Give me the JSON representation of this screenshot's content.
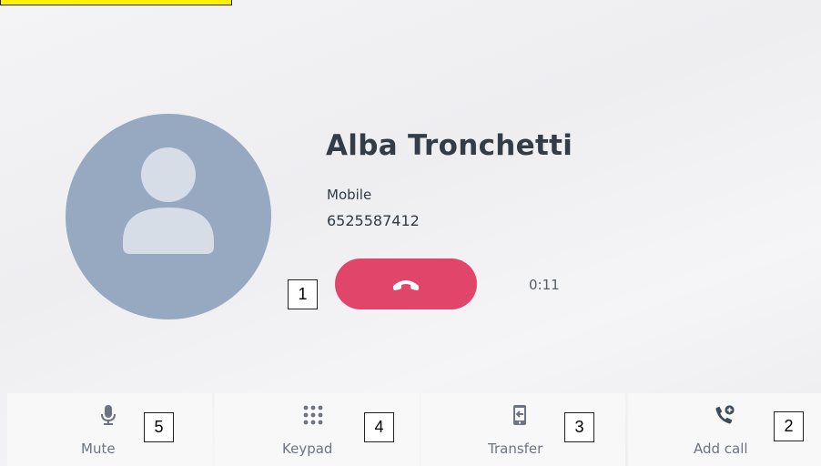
{
  "contact": {
    "name": "Alba Tronchetti",
    "phone_type": "Mobile",
    "phone_number": "6525587412"
  },
  "call": {
    "duration": "0:11",
    "end_call_icon": "end-call-icon"
  },
  "actions": [
    {
      "label": "Mute",
      "icon": "microphone-icon"
    },
    {
      "label": "Keypad",
      "icon": "keypad-icon"
    },
    {
      "label": "Transfer",
      "icon": "transfer-icon"
    },
    {
      "label": "Add call",
      "icon": "add-call-icon"
    }
  ],
  "markers": [
    "1",
    "2",
    "3",
    "4",
    "5"
  ],
  "colors": {
    "end_call": "#e2456a",
    "avatar": "#97a9c0",
    "highlight": "#fff200"
  }
}
